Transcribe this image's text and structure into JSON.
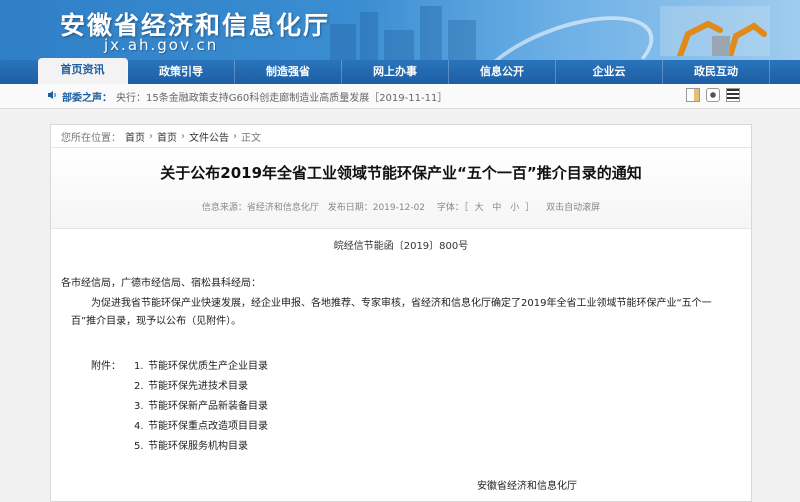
{
  "header": {
    "title": "安徽省经济和信息化厅",
    "domain": "jx.ah.gov.cn"
  },
  "nav": [
    {
      "label": "首页资讯",
      "active": true
    },
    {
      "label": "政策引导"
    },
    {
      "label": "制造强省"
    },
    {
      "label": "网上办事"
    },
    {
      "label": "信息公开"
    },
    {
      "label": "企业云"
    },
    {
      "label": "政民互动"
    }
  ],
  "ticker": {
    "label": "部委之声：",
    "text": "央行：15条金融政策支持G60科创走廊制造业高质量发展［2019-11-11］"
  },
  "breadcrumb": {
    "prefix": "您所在位置：",
    "items": [
      "首页",
      "首页",
      "文件公告",
      "正文"
    ],
    "sep": "›"
  },
  "article": {
    "title": "关于公布2019年全省工业领域节能环保产业“五个一百”推介目录的通知",
    "meta": {
      "source": "信息来源：省经济和信息化厅",
      "date": "发布日期：2019-12-02",
      "font_label": "字体：［",
      "font_large": "大",
      "font_medium": "中",
      "font_small": "小",
      "font_close": "］",
      "scroll": "双击自动滚屏"
    },
    "doc_number": "皖经信节能函〔2019〕800号",
    "salutation": "各市经信局，广德市经信局、宿松县科经局：",
    "paragraph": "为促进我省节能环保产业快速发展，经企业申报、各地推荐、专家审核，省经济和信息化厅确定了2019年全省工业领域节能环保产业“五个一百”推介目录，现予以公布（见附件）。",
    "attachments_label": "附件：",
    "attachments": [
      {
        "num": "1.",
        "text": "节能环保优质生产企业目录"
      },
      {
        "num": "2.",
        "text": "节能环保先进技术目录"
      },
      {
        "num": "3.",
        "text": "节能环保新产品新装备目录"
      },
      {
        "num": "4.",
        "text": "节能环保重点改造项目目录"
      },
      {
        "num": "5.",
        "text": "节能环保服务机构目录"
      }
    ],
    "signature": "安徽省经济和信息化厅"
  }
}
